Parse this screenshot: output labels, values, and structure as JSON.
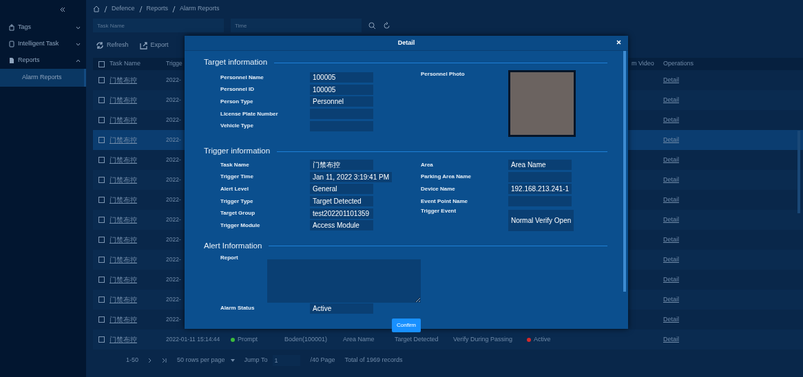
{
  "breadcrumb": [
    "Defence",
    "Reports",
    "Alarm Reports"
  ],
  "sidebar": {
    "items": [
      {
        "label": "Tags",
        "kind": "tag",
        "expanded": false
      },
      {
        "label": "Intelligent Task",
        "kind": "task",
        "expanded": false
      },
      {
        "label": "Reports",
        "kind": "report",
        "expanded": true,
        "children": [
          {
            "label": "Alarm Reports",
            "selected": true
          }
        ]
      }
    ]
  },
  "filters": [
    {
      "placeholder": "Task Name"
    },
    {
      "placeholder": "Time"
    }
  ],
  "toolbar": [
    {
      "label": "Refresh",
      "kind": "refresh"
    },
    {
      "label": "Export",
      "kind": "export"
    }
  ],
  "table": {
    "header": {
      "checked": false,
      "task_name": "Task Name",
      "column_3": "Trigge",
      "column_11": "m Video",
      "operations": "Operations"
    },
    "rows": [
      {
        "selected": false,
        "checked": false,
        "task_name": "门禁布控",
        "time": "2022-",
        "operations": "Detail"
      },
      {
        "selected": false,
        "checked": false,
        "task_name": "门禁布控",
        "time": "2022-",
        "operations": "Detail"
      },
      {
        "selected": false,
        "checked": false,
        "task_name": "门禁布控",
        "time": "2022-",
        "operations": "Detail"
      },
      {
        "selected": true,
        "checked": false,
        "task_name": "门禁布控",
        "time": "2022-",
        "operations": "Detail"
      },
      {
        "selected": false,
        "checked": false,
        "task_name": "门禁布控",
        "time": "2022-",
        "operations": "Detail"
      },
      {
        "selected": false,
        "checked": false,
        "task_name": "门禁布控",
        "time": "2022-",
        "operations": "Detail"
      },
      {
        "selected": false,
        "checked": false,
        "task_name": "门禁布控",
        "time": "2022-",
        "operations": "Detail"
      },
      {
        "selected": false,
        "checked": false,
        "task_name": "门禁布控",
        "time": "2022-",
        "operations": "Detail"
      },
      {
        "selected": false,
        "checked": false,
        "task_name": "门禁布控",
        "time": "2022-",
        "operations": "Detail"
      },
      {
        "selected": false,
        "checked": false,
        "task_name": "门禁布控",
        "time": "2022-",
        "operations": "Detail"
      },
      {
        "selected": false,
        "checked": false,
        "task_name": "门禁布控",
        "time": "2022-",
        "operations": "Detail"
      },
      {
        "selected": false,
        "checked": false,
        "task_name": "门禁布控",
        "time": "2022-",
        "operations": "Detail"
      },
      {
        "selected": false,
        "checked": false,
        "task_name": "门禁布控",
        "time": "2022-",
        "operations": "Detail"
      },
      {
        "selected": false,
        "checked": false,
        "task_name": "门禁布控",
        "time": "2022-01-11 15:14:44",
        "level": {
          "label": "Prompt",
          "color": "#3dbb3d"
        },
        "person": "Boden(100001)",
        "area": "Area Name",
        "trigger_type": "Target Detected",
        "event": "Verify During Passing",
        "status": {
          "label": "Active",
          "color": "#d42a2a"
        },
        "operations": "Detail"
      }
    ]
  },
  "pagination": {
    "range": "1-50",
    "page_size": "50 rows per page",
    "jump_label": "Jump To",
    "jump_value": "1",
    "pages": "/40 Page",
    "total": "Total of 1969 records"
  },
  "dialog": {
    "title": "Detail",
    "sections": [
      {
        "title": "Target information",
        "left": [
          {
            "label": "Personnel Name",
            "value": "100005"
          },
          {
            "label": "Personnel ID",
            "value": "100005"
          },
          {
            "label": "Person Type",
            "value": "Personnel"
          },
          {
            "label": "License Plate Number"
          },
          {
            "label": "Vehicle Type"
          }
        ],
        "right": [
          {
            "label": "Personnel Photo",
            "kind": "photo"
          }
        ]
      },
      {
        "title": "Trigger information",
        "left": [
          {
            "label": "Task Name",
            "value": "门禁布控"
          },
          {
            "label": "Trigger Time",
            "value": "Jan 11, 2022 3:19:41 PM"
          },
          {
            "label": "Alert Level",
            "value": "General"
          },
          {
            "label": "Trigger Type",
            "value": "Target Detected"
          },
          {
            "label": "Target Group",
            "value": "test202201101359"
          },
          {
            "label": "Trigger Module",
            "value": "Access Module"
          }
        ],
        "right": [
          {
            "label": "Area",
            "value": "Area Name"
          },
          {
            "label": "Parking Area Name"
          },
          {
            "label": "Device Name",
            "value": "192.168.213.241-1"
          },
          {
            "label": "Event Point Name"
          },
          {
            "label": "Trigger Event",
            "value": "Normal Verify Open",
            "kind": "tall"
          }
        ]
      },
      {
        "title": "Alert Information",
        "left": [
          {
            "label": "Report",
            "kind": "textarea"
          },
          {
            "label": "Alarm Status",
            "value": "Active"
          }
        ]
      }
    ],
    "confirm": "Confirm"
  }
}
